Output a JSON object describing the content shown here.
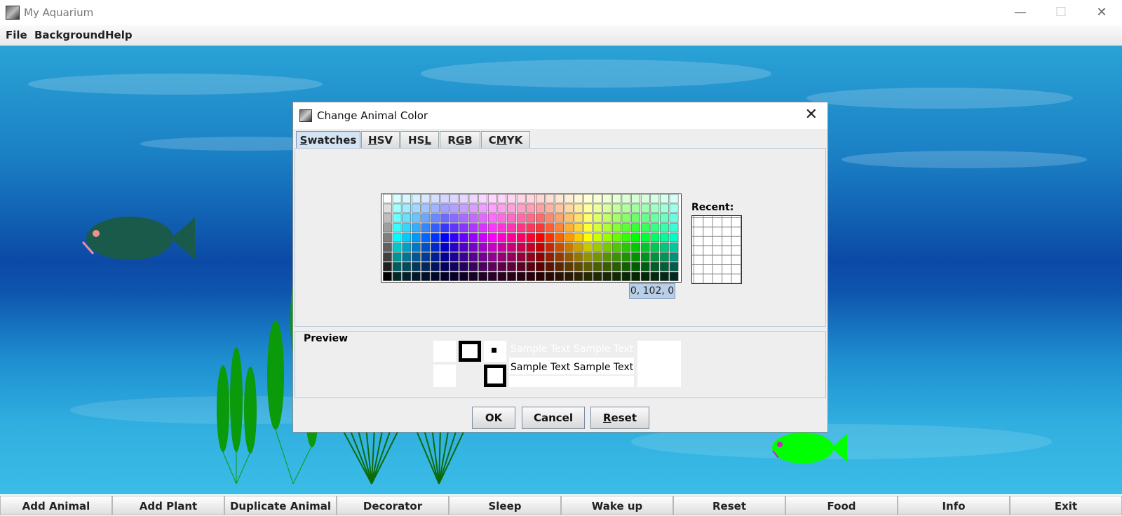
{
  "window": {
    "title": "My Aquarium"
  },
  "menu": [
    "File",
    "Background",
    "Help"
  ],
  "bottom_buttons": [
    "Add Animal",
    "Add Plant",
    "Duplicate Animal",
    "Decorator",
    "Sleep",
    "Wake up",
    "Reset",
    "Food",
    "Info",
    "Exit"
  ],
  "dialog": {
    "title": "Change Animal Color",
    "tabs": [
      {
        "label": "Swatches",
        "mnemonic_index": 0
      },
      {
        "label": "HSV",
        "mnemonic_index": 0
      },
      {
        "label": "HSL",
        "mnemonic_index": 2
      },
      {
        "label": "RGB",
        "mnemonic_index": 1
      },
      {
        "label": "CMYK",
        "mnemonic_index": 1
      }
    ],
    "active_tab": "Swatches",
    "recent_label": "Recent:",
    "tooltip": "0, 102, 0",
    "preview_label": "Preview",
    "sample_text": "Sample Text",
    "buttons": {
      "ok": "OK",
      "cancel": "Cancel",
      "reset": "Reset"
    }
  },
  "colors": {
    "fish_dark": "#1a5a4a",
    "fish_dark_eye": "#f09090",
    "fish_green": "#00ff00",
    "fish_green_eye": "#cc22cc",
    "plant": "#0a9a0a",
    "grass": "#0b6a0b",
    "selection_tab": "#d4e4f4"
  }
}
